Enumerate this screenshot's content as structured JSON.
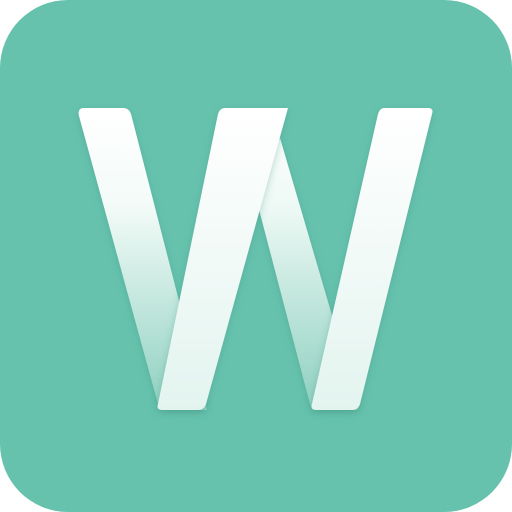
{
  "app_icon": {
    "icon": "letter-w-logo-icon",
    "logo_text": "W",
    "colors": {
      "background": "#66c2ad",
      "glyph_light": "#ffffff",
      "glyph_mint": "#e3f4ef",
      "glyph_fade": "#8ed0c0"
    }
  }
}
